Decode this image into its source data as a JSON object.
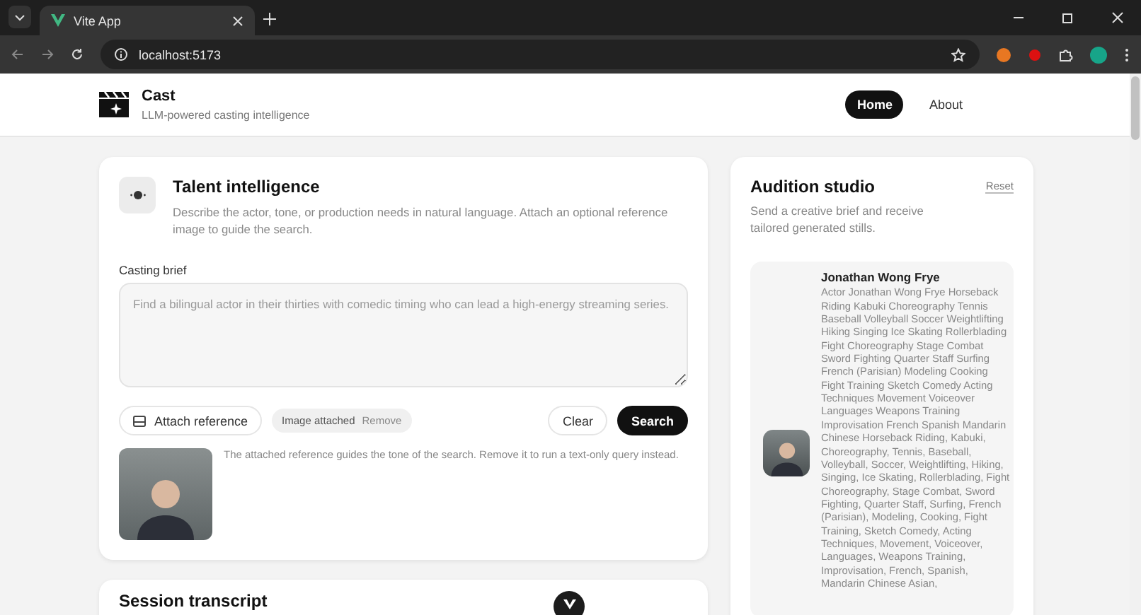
{
  "browser": {
    "tab_title": "Vite App",
    "address": "localhost:5173"
  },
  "header": {
    "brand": "Cast",
    "tagline": "LLM-powered casting intelligence",
    "nav": [
      {
        "label": "Home",
        "selected": true
      },
      {
        "label": "About",
        "selected": false
      }
    ]
  },
  "search_card": {
    "title": "Talent intelligence",
    "description": "Describe the actor, tone, or production needs in natural language. Attach an optional reference image to guide the search.",
    "field_label": "Casting brief",
    "placeholder": "Find a bilingual actor in their thirties with comedic timing who can lead a high-energy streaming series.",
    "attach_button": "Attach reference",
    "attachment": {
      "label": "Image attached",
      "remove": "Remove"
    },
    "clear_button": "Clear",
    "search_button": "Search",
    "reference_note": "The attached reference guides the tone of the search. Remove it to run a text-only query instead."
  },
  "transcript_card": {
    "title": "Session transcript"
  },
  "studio": {
    "title": "Audition studio",
    "reset": "Reset",
    "description": "Send a creative brief and receive tailored generated stills.",
    "result": {
      "name": "Jonathan Wong Frye",
      "bio": "Actor Jonathan Wong Frye Horseback Riding Kabuki Choreography Tennis Baseball Volleyball Soccer Weightlifting Hiking Singing Ice Skating Rollerblading Fight Choreography Stage Combat Sword Fighting Quarter Staff Surfing French (Parisian) Modeling Cooking Fight Training Sketch Comedy Acting Techniques Movement Voiceover Languages Weapons Training Improvisation French Spanish Mandarin Chinese Horseback Riding, Kabuki, Choreography, Tennis, Baseball, Volleyball, Soccer, Weightlifting, Hiking, Singing, Ice Skating, Rollerblading, Fight Choreography, Stage Combat, Sword Fighting, Quarter Staff, Surfing, French (Parisian), Modeling, Cooking, Fight Training, Sketch Comedy, Acting Techniques, Movement, Voiceover, Languages, Weapons Training, Improvisation, French, Spanish, Mandarin Chinese Asian,"
    }
  }
}
